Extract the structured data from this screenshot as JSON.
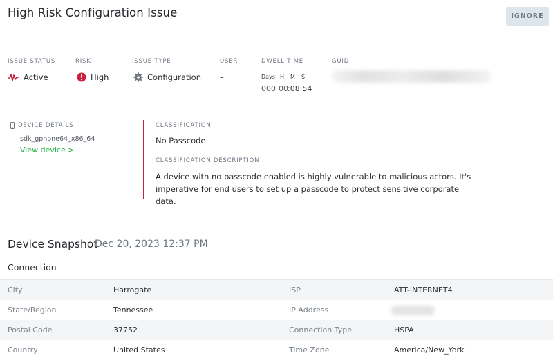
{
  "header": {
    "title": "High Risk Configuration Issue",
    "ignore_label": "IGNORE"
  },
  "summary": {
    "issue_status": {
      "label": "ISSUE STATUS",
      "value": "Active",
      "icon": "activity-icon"
    },
    "risk": {
      "label": "RISK",
      "value": "High",
      "icon": "alert-circle-icon",
      "color": "#c8213d"
    },
    "issue_type": {
      "label": "ISSUE TYPE",
      "value": "Configuration",
      "icon": "gear-icon"
    },
    "user": {
      "label": "USER",
      "value": "–"
    },
    "dwell_time": {
      "label": "DWELL TIME",
      "days_label": "Days",
      "h_label": "H",
      "m_label": "M",
      "s_label": "S",
      "days": "000",
      "hms_prefix": "00",
      "hms_rest": ":08:54"
    },
    "guid": {
      "label": "GUID"
    }
  },
  "device": {
    "label": "DEVICE DETAILS",
    "model": "sdk_gphone64_x86_64",
    "link": "View device >"
  },
  "classification": {
    "label": "CLASSIFICATION",
    "value": "No Passcode",
    "desc_label": "CLASSIFICATION DESCRIPTION",
    "description": "A device with no passcode enabled is highly vulnerable to malicious actors. It's imperative for end users to set up a passcode to protect sensitive corporate data."
  },
  "snapshot": {
    "title": "Device Snapshot",
    "date": "Dec 20, 2023 12:37 PM",
    "connection_title": "Connection",
    "rows": [
      {
        "k1": "City",
        "v1": "Harrogate",
        "k2": "ISP",
        "v2": "ATT-INTERNET4"
      },
      {
        "k1": "State/Region",
        "v1": "Tennessee",
        "k2": "IP Address",
        "v2": ""
      },
      {
        "k1": "Postal Code",
        "v1": "37752",
        "k2": "Connection Type",
        "v2": "HSPA"
      },
      {
        "k1": "Country",
        "v1": "United States",
        "k2": "Time Zone",
        "v2": "America/New_York"
      }
    ]
  },
  "colors": {
    "accent_green": "#1fb145",
    "danger": "#c8213d",
    "button_bg": "#dfe5ec"
  }
}
